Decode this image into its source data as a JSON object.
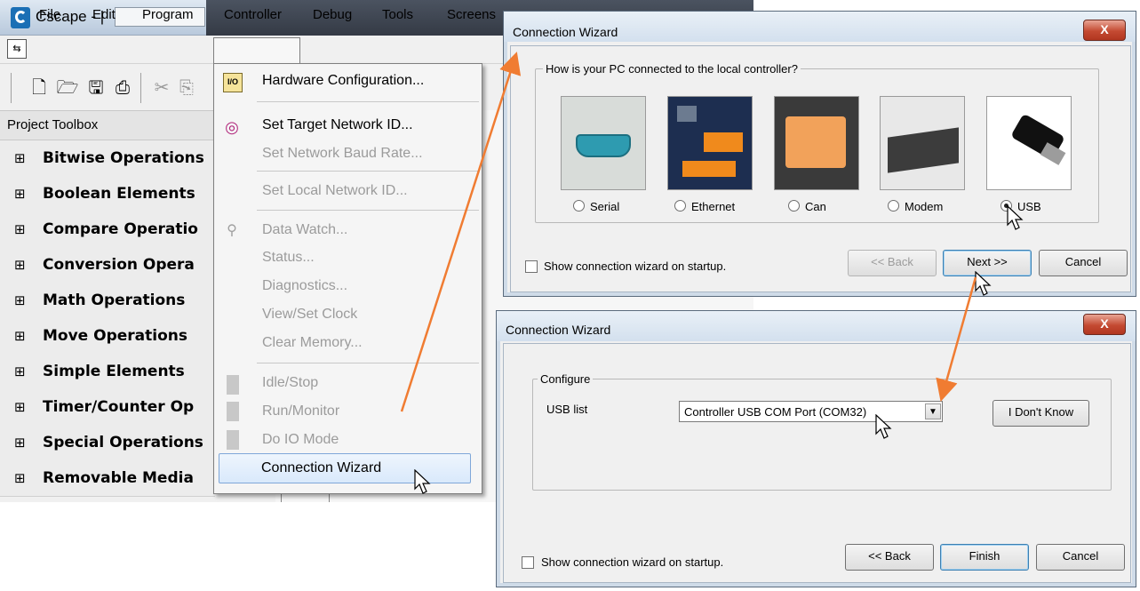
{
  "app": {
    "title": "Cscape - |"
  },
  "menu": [
    "File",
    "Edit",
    "Program",
    "Controller",
    "Debug",
    "Tools",
    "Screens"
  ],
  "toolbox": {
    "title": "Project Toolbox",
    "items": [
      "Bitwise Operations",
      "Boolean Elements",
      "Compare Operatio",
      "Conversion Opera",
      "Math Operations",
      "Move Operations",
      "Simple Elements",
      "Timer/Counter Op",
      "Special Operations",
      "Removable Media"
    ]
  },
  "controller_menu": {
    "hardware_configuration": "Hardware Configuration...",
    "set_target_network_id": "Set Target Network ID...",
    "set_network_baud_rate": "Set Network Baud Rate...",
    "set_local_network_id": "Set Local Network ID...",
    "data_watch": "Data Watch...",
    "status": "Status...",
    "diagnostics": "Diagnostics...",
    "view_set_clock": "View/Set Clock",
    "clear_memory": "Clear Memory...",
    "idle_stop": "Idle/Stop",
    "run_monitor": "Run/Monitor",
    "do_io_mode": "Do IO Mode",
    "connection_wizard": "Connection Wizard",
    "hw_icon_text": "I/O"
  },
  "wizard1": {
    "title": "Connection Wizard",
    "close": "X",
    "question": "How is your PC connected to the local controller?",
    "options": [
      "Serial",
      "Ethernet",
      "Can",
      "Modem",
      "USB"
    ],
    "selected": "USB",
    "show_on_startup": "Show connection wizard on startup.",
    "back": "<< Back",
    "next": "Next >>",
    "cancel": "Cancel"
  },
  "wizard2": {
    "title": "Connection Wizard",
    "close": "X",
    "group": "Configure",
    "usb_list_label": "USB list",
    "usb_list_value": "Controller USB COM Port (COM32)",
    "dont_know": "I Don't Know",
    "show_on_startup": "Show connection wizard on startup.",
    "back": "<< Back",
    "finish": "Finish",
    "cancel": "Cancel"
  },
  "colors": {
    "arrow": "#f07c32",
    "highlight": "#d9e9fb",
    "close_button": "#c44a32"
  }
}
